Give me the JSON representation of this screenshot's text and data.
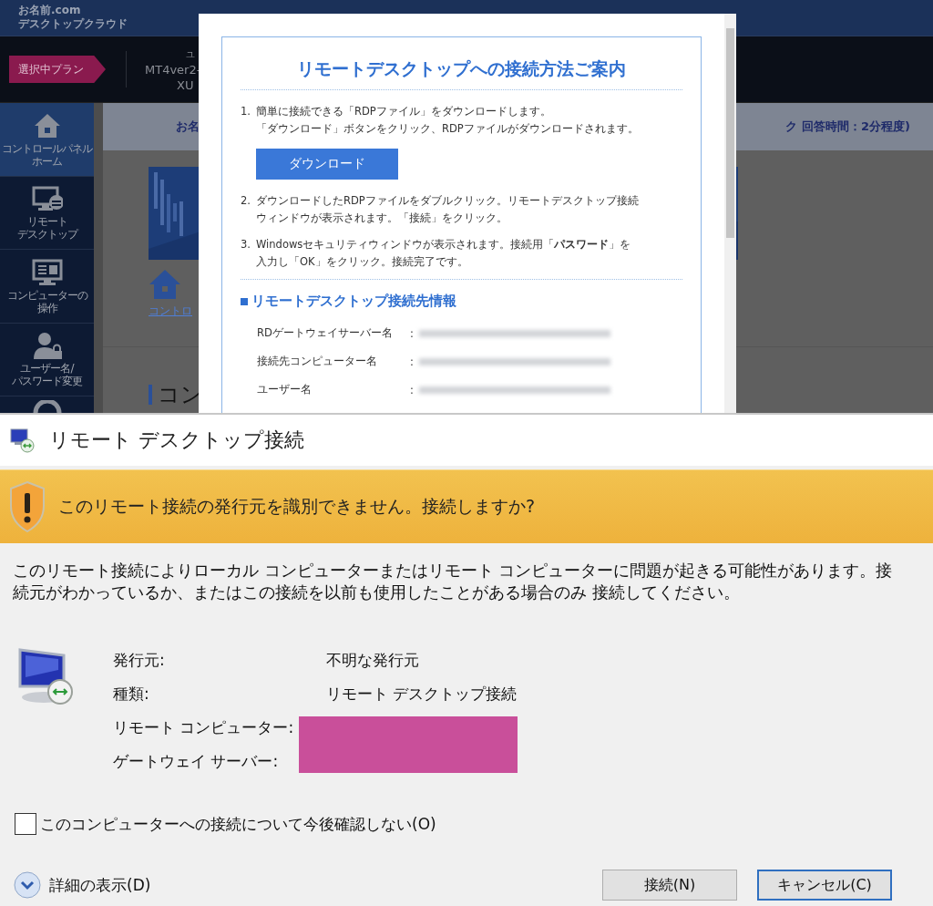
{
  "web_page": {
    "header": {
      "logo": [
        "お名前.com",
        "デスクトップクラウド"
      ]
    },
    "plan_bar": {
      "tag": "選択中プラン",
      "lines": [
        "ユ",
        "MT4ver2-",
        "XU"
      ]
    },
    "sidebar": {
      "items": [
        {
          "lines": [
            "コントロールパネル",
            "ホーム"
          ],
          "selected": true
        },
        {
          "lines": [
            "リモート",
            "デスクトップ"
          ],
          "selected": false
        },
        {
          "lines": [
            "コンピューターの",
            "操作"
          ],
          "selected": false
        },
        {
          "lines": [
            "ユーザー名/",
            "パスワード変更"
          ],
          "selected": false
        }
      ]
    },
    "notice": [
      "お名",
      "ク 回答時間：2分程度)"
    ],
    "breadcrumb": "コントロ",
    "section_heading": "コン"
  },
  "modal": {
    "title": "リモートデスクトップへの接続方法ご案内",
    "steps": [
      {
        "number": "1.",
        "lines": [
          "簡単に接続できる「RDPファイル」をダウンロードします。",
          "「ダウンロード」ボタンをクリック、RDPファイルがダウンロードされます。"
        ],
        "button": "ダウンロード"
      },
      {
        "number": "2.",
        "lines": [
          "ダウンロードしたRDPファイルをダブルクリック。リモートデスクトップ接続",
          "ウィンドウが表示されます。「接続」をクリック。"
        ]
      },
      {
        "number": "3.",
        "lines": [
          "Windowsセキュリティウィンドウが表示されます。接続用「**パスワード**」を",
          "入力し「OK」をクリック。接続完了です。"
        ]
      }
    ],
    "info_heading": "リモートデスクトップ接続先情報",
    "info_rows": [
      {
        "label": "RDゲートウェイサーバー名",
        "separator": ":",
        "value_blurred": true
      },
      {
        "label": "接続先コンピューター名",
        "separator": ":",
        "value_blurred": true
      },
      {
        "label": "ユーザー名",
        "separator": ":",
        "value_blurred": true
      }
    ]
  },
  "dialog": {
    "title": "リモート デスクトップ接続",
    "warning": "このリモート接続の発行元を識別できません。接続しますか?",
    "message": [
      "このリモート接続によりローカル コンピューターまたはリモート コンピューターに問題が起きる可能性があります。接",
      "続元がわかっているか、またはこの接続を以前も使用したことがある場合のみ 接続してください。"
    ],
    "details": [
      {
        "label": "発行元:",
        "value": "不明な発行元",
        "redacted": false
      },
      {
        "label": "種類:",
        "value": "リモート デスクトップ接続",
        "redacted": false
      },
      {
        "label": "リモート コンピューター:",
        "redacted": true
      },
      {
        "label": "ゲートウェイ サーバー:",
        "redacted": true
      }
    ],
    "dont_ask": {
      "label": "このコンピューターへの接続について今後確認しない(O)",
      "checked": false
    },
    "details_toggle": {
      "label": "詳細の表示(D)",
      "expanded": false
    },
    "buttons": [
      {
        "label": "接続(N)",
        "focused": false
      },
      {
        "label": "キャンセル(C)",
        "focused": true
      }
    ]
  }
}
